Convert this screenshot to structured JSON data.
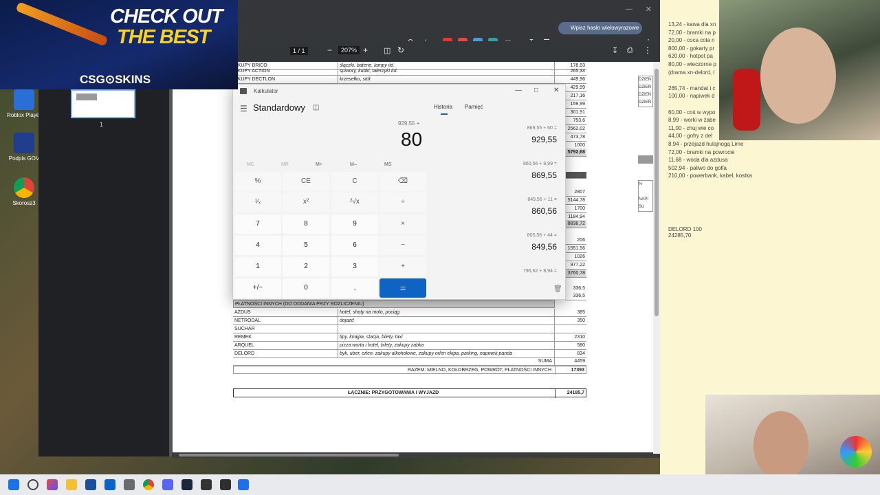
{
  "banner": {
    "line1": "CHECK OUT",
    "line2": "THE BEST",
    "logo": "CSG⊙SKINS"
  },
  "desktop": {
    "icons": [
      "Roblox Player",
      "Podpis GOV",
      "Skorosz3"
    ]
  },
  "browser": {
    "password_pill": "Wpisz hasło wielowyrazowe",
    "page_counter": "1 / 1",
    "zoom": "207%",
    "thumbnail_page": "1"
  },
  "pdf": {
    "top_rows": [
      {
        "c1": "AKUPY BRICO",
        "c2": "ślączki, baterie, lampy itd.",
        "c3": "178,93"
      },
      {
        "c1": "AKUPY ACTION",
        "c2": "spiwory, kubki, talerzyki itd.",
        "c3": "265,34"
      },
      {
        "c1": "AKUPY DECTLON",
        "c2": "krzesełko, stół",
        "c3": "449,96"
      }
    ],
    "right_numbers": [
      "429,99",
      "217,16",
      "159,99",
      "301,91",
      "753,6",
      "2562,02",
      "473,78",
      "1000",
      "5792,68",
      "2807",
      "5144,78",
      "1700",
      "1184,94",
      "8836,72",
      "206",
      "1551,56",
      "1026",
      "977,22",
      "3760,78",
      "336,5",
      "336,5"
    ],
    "section_header": "PŁATNOŚCI INNYCH (DO ODDANIA PRZY ROZLICZENIU)",
    "rows": [
      {
        "c1": "AZDUS",
        "c2": "hotel, shoty na molo, pociąg",
        "c3": "385"
      },
      {
        "c1": "NETRODAL",
        "c2": "dojazd",
        "c3": "350"
      },
      {
        "c1": "SUCHAR",
        "c2": "",
        "c3": ""
      },
      {
        "c1": "REMEK",
        "c2": "tipy, knajpa, stacja, bilety, taxi",
        "c3": "2310"
      },
      {
        "c1": "ARQUEL",
        "c2": "pizza worta i hotel, bilety, zakupy żabka",
        "c3": "580"
      },
      {
        "c1": "DELORD",
        "c2": "byk, uber, orlen, zakupy alkoholowe, zakupy orlen ekipa, parking, napiwek panda",
        "c3": "834"
      }
    ],
    "suma_label": "SUMA",
    "suma_value": "4459",
    "razem_label": "RAZEM: MIELNO, KOŁOBRZEG, POWRÓT, PŁATNOŚCI INNYCH",
    "razem_value": "17393",
    "total_label": "ŁĄCZNIE: PRZYGOTOWANIA I WYJAZD",
    "total_value": "24185,7",
    "side_labels": [
      "DZIEŃ",
      "DZIEŃ",
      "DZIEŃ",
      "DZIEŃ",
      "%",
      "NAPI",
      "SU"
    ]
  },
  "calculator": {
    "title": "Kalkulator",
    "mode": "Standardowy",
    "tab_history": "Historia",
    "tab_memory": "Pamięć",
    "expression": "929,55 +",
    "display": "80",
    "memory_keys": [
      "MC",
      "MR",
      "M+",
      "M–",
      "MS"
    ],
    "keys": [
      [
        "%",
        "CE",
        "C",
        "⌫"
      ],
      [
        "¹⁄ₓ",
        "x²",
        "²√x",
        "÷"
      ],
      [
        "7",
        "8",
        "9",
        "×"
      ],
      [
        "4",
        "5",
        "6",
        "−"
      ],
      [
        "1",
        "2",
        "3",
        "+"
      ],
      [
        "+/−",
        "0",
        ",",
        "="
      ]
    ],
    "history": [
      {
        "expr": "869,55  +  60 =",
        "result": "929,55"
      },
      {
        "expr": "860,56  +  8,99 =",
        "result": "869,55"
      },
      {
        "expr": "849,56  +  11 =",
        "result": "860,56"
      },
      {
        "expr": "805,56  +  44 =",
        "result": "849,56"
      },
      {
        "expr": "796,62  +  8,94 =",
        "result": ""
      }
    ]
  },
  "notes": {
    "lines": [
      "13,24 - kawa dla xn",
      "72,00 - bramki na p",
      "20,00 - coca cola n",
      "800,00 - gokarty pr",
      "620,00 - hotpot pa",
      "80,00 - wieczorne p",
      "(drama xn-delord, l",
      "",
      "265,74 - mandat i c",
      "100,00 - napiwek d",
      "",
      "60,00 - coś w wypo",
      "8,99 - worki w żabe",
      "11,00 - chuj wie co",
      "44,00 - gofry z del",
      "8,94 - przejazd hulajnogą Lime",
      "72,00 - bramki na powrocie",
      "11,68 - woda dla azdusa",
      "502,94 - paliwo do golfa",
      "210,00 - powerbank, kabel, kostka"
    ],
    "footer1": "DELORD 100",
    "footer2": "24285,70"
  }
}
